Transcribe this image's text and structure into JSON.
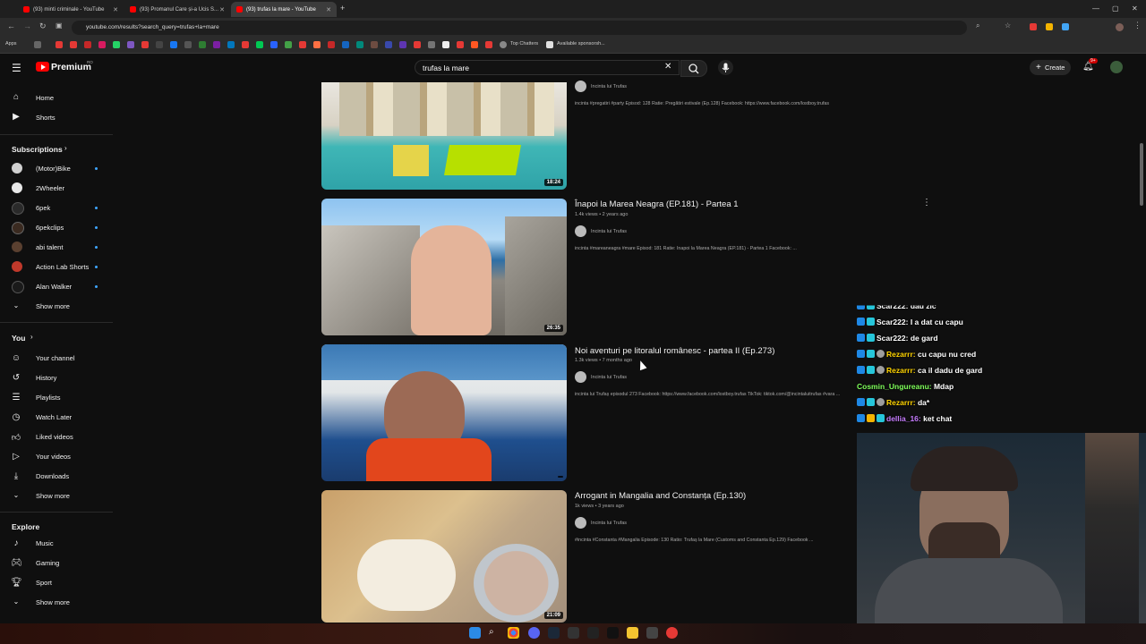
{
  "browser": {
    "tabs": [
      {
        "title": "(93) minti criminale - YouTube"
      },
      {
        "title": "(93) Promanul Care și-a Ucis S..."
      },
      {
        "title": "(93) trufas la mare - YouTube"
      }
    ],
    "url": "youtube.com/results?search_query=trufas+la+mare",
    "bookmarks": {
      "apps": "Apps",
      "top_chatters": "Top Chatters",
      "available": "Available sponsorsh..."
    }
  },
  "youtube": {
    "logo_text": "Premium",
    "logo_region": "RO",
    "search_value": "trufas la mare",
    "create_label": "Create",
    "notif_count": "9+"
  },
  "sidebar": {
    "home": "Home",
    "shorts": "Shorts",
    "subscriptions_title": "Subscriptions",
    "subs": [
      {
        "name": "(Motor)Bike",
        "color": "#d0d0d0"
      },
      {
        "name": "2Wheeler",
        "color": "#e8e8e8"
      },
      {
        "name": "6pek",
        "color": "#2a2a2a"
      },
      {
        "name": "6pekclips",
        "color": "#3a2a20"
      },
      {
        "name": "abi talent",
        "color": "#5a4030"
      },
      {
        "name": "Action Lab Shorts",
        "color": "#c0392b"
      },
      {
        "name": "Alan Walker",
        "color": "#1a1a1a"
      }
    ],
    "show_more": "Show more",
    "you_title": "You",
    "you_items": [
      "Your channel",
      "History",
      "Playlists",
      "Watch Later",
      "Liked videos",
      "Your videos",
      "Downloads"
    ],
    "show_more_2": "Show more",
    "explore_title": "Explore",
    "explore_items": [
      "Music",
      "Gaming",
      "Sport"
    ],
    "show_more_3": "Show more"
  },
  "results": [
    {
      "title": "",
      "meta": "",
      "channel": "Incinta lui Trufas",
      "desc": "incinta #pregatiri #party Episod: 128 Ratie: Pregătiri estivale (Ep.128) Facebook: https://www.facebook.com/lostboy.trufas",
      "duration": "18:24"
    },
    {
      "title": "Înapoi la Marea Neagra (EP.181) - Partea 1",
      "meta": "1.4k views • 2 years ago",
      "channel": "Incinta lui Trufas",
      "desc": "incinta #mareaneagra #mare Episod: 181 Ratie: Înapoi la Marea Neagra (EP.181) - Partea 1 Facebook: ...",
      "duration": "26:35"
    },
    {
      "title": "Noi aventuri pe litoralul românesc - partea II (Ep.273)",
      "meta": "1.3k views • 7 months ago",
      "channel": "Incinta lui Trufas",
      "desc": "incinta lui Trufaș episodul 273 Facebook: https://www.facebook.com/lostboy.trufas TikTok: tiktok.com/@incintaluitrufas #vara ...",
      "duration": ""
    },
    {
      "title": "Arrogant in Mangalia and Constanța (Ep.130)",
      "meta": "1k views • 3 years ago",
      "channel": "Incinta lui Trufas",
      "desc": "#incinta #Constanta #Mangalia Episode: 130 Ratio: Trufaș la Mare (Customs and Constanta Ep.129) Facebook ...",
      "duration": "21:09"
    }
  ],
  "chat": [
    {
      "user": "Scar222:",
      "msg": "dau zic",
      "color": "#ffffff"
    },
    {
      "user": "Scar222:",
      "msg": "I a dat cu capu",
      "color": "#ffffff"
    },
    {
      "user": "Scar222:",
      "msg": "de gard",
      "color": "#ffffff"
    },
    {
      "user": "Rezarrr:",
      "msg": "cu capu nu cred",
      "color": "#ffd400"
    },
    {
      "user": "Rezarrr:",
      "msg": "ca il dadu de gard",
      "color": "#ffd400"
    },
    {
      "user": "Cosmin_Ungureanu:",
      "msg": "Mdap",
      "color": "#7fff5a"
    },
    {
      "user": "Rezarrr:",
      "msg": "da*",
      "color": "#ffd400"
    },
    {
      "user": "dellia_16:",
      "msg": "ket      chat",
      "color": "#c77dff"
    }
  ]
}
